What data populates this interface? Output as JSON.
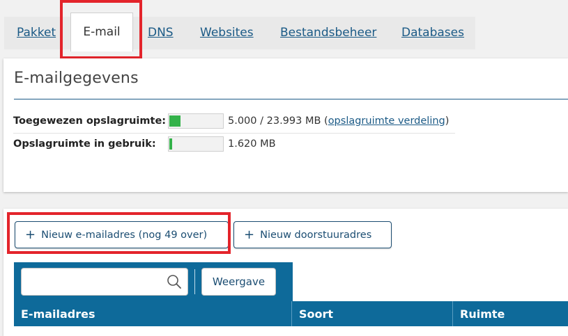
{
  "tabs": [
    {
      "label": "Pakket"
    },
    {
      "label": "E-mail"
    },
    {
      "label": "DNS"
    },
    {
      "label": "Websites"
    },
    {
      "label": "Bestandsbeheer"
    },
    {
      "label": "Databases"
    }
  ],
  "email_panel": {
    "title": "E-mailgegevens",
    "assigned": {
      "label": "Toegewezen opslagruimte:",
      "value": "5.000 / 23.993 MB (",
      "link": "opslagruimte verdeling",
      "close": ")",
      "progress": 0.21
    },
    "used": {
      "label": "Opslagruimte in gebruik:",
      "value": "1.620 MB",
      "progress": 0.05
    }
  },
  "actions": {
    "new_email": "Nieuw e-mailadres (nog 49 over)",
    "new_forward": "Nieuw doorstuuradres",
    "plus_icon": "+"
  },
  "toolbar": {
    "search_placeholder": "",
    "view_label": "Weergave"
  },
  "table": {
    "columns": [
      "E-mailadres",
      "Soort",
      "Ruimte"
    ]
  },
  "colors": {
    "brand": "#0e6a9a",
    "link": "#1b5a86",
    "progress": "#34b24a",
    "highlight": "#e3242b"
  }
}
